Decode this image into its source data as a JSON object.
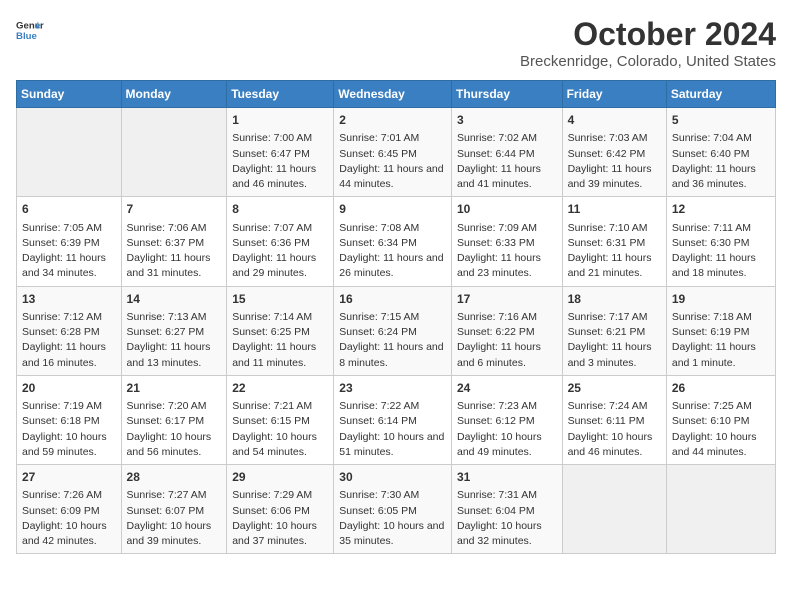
{
  "logo": {
    "text_general": "General",
    "text_blue": "Blue"
  },
  "title": "October 2024",
  "subtitle": "Breckenridge, Colorado, United States",
  "days_of_week": [
    "Sunday",
    "Monday",
    "Tuesday",
    "Wednesday",
    "Thursday",
    "Friday",
    "Saturday"
  ],
  "weeks": [
    [
      {
        "day": "",
        "content": ""
      },
      {
        "day": "",
        "content": ""
      },
      {
        "day": "1",
        "content": "Sunrise: 7:00 AM\nSunset: 6:47 PM\nDaylight: 11 hours and 46 minutes."
      },
      {
        "day": "2",
        "content": "Sunrise: 7:01 AM\nSunset: 6:45 PM\nDaylight: 11 hours and 44 minutes."
      },
      {
        "day": "3",
        "content": "Sunrise: 7:02 AM\nSunset: 6:44 PM\nDaylight: 11 hours and 41 minutes."
      },
      {
        "day": "4",
        "content": "Sunrise: 7:03 AM\nSunset: 6:42 PM\nDaylight: 11 hours and 39 minutes."
      },
      {
        "day": "5",
        "content": "Sunrise: 7:04 AM\nSunset: 6:40 PM\nDaylight: 11 hours and 36 minutes."
      }
    ],
    [
      {
        "day": "6",
        "content": "Sunrise: 7:05 AM\nSunset: 6:39 PM\nDaylight: 11 hours and 34 minutes."
      },
      {
        "day": "7",
        "content": "Sunrise: 7:06 AM\nSunset: 6:37 PM\nDaylight: 11 hours and 31 minutes."
      },
      {
        "day": "8",
        "content": "Sunrise: 7:07 AM\nSunset: 6:36 PM\nDaylight: 11 hours and 29 minutes."
      },
      {
        "day": "9",
        "content": "Sunrise: 7:08 AM\nSunset: 6:34 PM\nDaylight: 11 hours and 26 minutes."
      },
      {
        "day": "10",
        "content": "Sunrise: 7:09 AM\nSunset: 6:33 PM\nDaylight: 11 hours and 23 minutes."
      },
      {
        "day": "11",
        "content": "Sunrise: 7:10 AM\nSunset: 6:31 PM\nDaylight: 11 hours and 21 minutes."
      },
      {
        "day": "12",
        "content": "Sunrise: 7:11 AM\nSunset: 6:30 PM\nDaylight: 11 hours and 18 minutes."
      }
    ],
    [
      {
        "day": "13",
        "content": "Sunrise: 7:12 AM\nSunset: 6:28 PM\nDaylight: 11 hours and 16 minutes."
      },
      {
        "day": "14",
        "content": "Sunrise: 7:13 AM\nSunset: 6:27 PM\nDaylight: 11 hours and 13 minutes."
      },
      {
        "day": "15",
        "content": "Sunrise: 7:14 AM\nSunset: 6:25 PM\nDaylight: 11 hours and 11 minutes."
      },
      {
        "day": "16",
        "content": "Sunrise: 7:15 AM\nSunset: 6:24 PM\nDaylight: 11 hours and 8 minutes."
      },
      {
        "day": "17",
        "content": "Sunrise: 7:16 AM\nSunset: 6:22 PM\nDaylight: 11 hours and 6 minutes."
      },
      {
        "day": "18",
        "content": "Sunrise: 7:17 AM\nSunset: 6:21 PM\nDaylight: 11 hours and 3 minutes."
      },
      {
        "day": "19",
        "content": "Sunrise: 7:18 AM\nSunset: 6:19 PM\nDaylight: 11 hours and 1 minute."
      }
    ],
    [
      {
        "day": "20",
        "content": "Sunrise: 7:19 AM\nSunset: 6:18 PM\nDaylight: 10 hours and 59 minutes."
      },
      {
        "day": "21",
        "content": "Sunrise: 7:20 AM\nSunset: 6:17 PM\nDaylight: 10 hours and 56 minutes."
      },
      {
        "day": "22",
        "content": "Sunrise: 7:21 AM\nSunset: 6:15 PM\nDaylight: 10 hours and 54 minutes."
      },
      {
        "day": "23",
        "content": "Sunrise: 7:22 AM\nSunset: 6:14 PM\nDaylight: 10 hours and 51 minutes."
      },
      {
        "day": "24",
        "content": "Sunrise: 7:23 AM\nSunset: 6:12 PM\nDaylight: 10 hours and 49 minutes."
      },
      {
        "day": "25",
        "content": "Sunrise: 7:24 AM\nSunset: 6:11 PM\nDaylight: 10 hours and 46 minutes."
      },
      {
        "day": "26",
        "content": "Sunrise: 7:25 AM\nSunset: 6:10 PM\nDaylight: 10 hours and 44 minutes."
      }
    ],
    [
      {
        "day": "27",
        "content": "Sunrise: 7:26 AM\nSunset: 6:09 PM\nDaylight: 10 hours and 42 minutes."
      },
      {
        "day": "28",
        "content": "Sunrise: 7:27 AM\nSunset: 6:07 PM\nDaylight: 10 hours and 39 minutes."
      },
      {
        "day": "29",
        "content": "Sunrise: 7:29 AM\nSunset: 6:06 PM\nDaylight: 10 hours and 37 minutes."
      },
      {
        "day": "30",
        "content": "Sunrise: 7:30 AM\nSunset: 6:05 PM\nDaylight: 10 hours and 35 minutes."
      },
      {
        "day": "31",
        "content": "Sunrise: 7:31 AM\nSunset: 6:04 PM\nDaylight: 10 hours and 32 minutes."
      },
      {
        "day": "",
        "content": ""
      },
      {
        "day": "",
        "content": ""
      }
    ]
  ]
}
